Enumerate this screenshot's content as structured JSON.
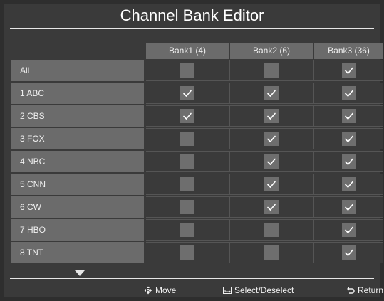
{
  "title": "Channel Bank Editor",
  "banks": [
    "Bank1 (4)",
    "Bank2 (6)",
    "Bank3 (36)"
  ],
  "channels": [
    {
      "name": "All",
      "b1": false,
      "b2": false,
      "b3": true
    },
    {
      "name": "1 ABC",
      "b1": true,
      "b2": true,
      "b3": true
    },
    {
      "name": "2 CBS",
      "b1": true,
      "b2": true,
      "b3": true
    },
    {
      "name": "3 FOX",
      "b1": false,
      "b2": true,
      "b3": true
    },
    {
      "name": "4 NBC",
      "b1": false,
      "b2": true,
      "b3": true
    },
    {
      "name": "5 CNN",
      "b1": false,
      "b2": true,
      "b3": true
    },
    {
      "name": "6 CW",
      "b1": false,
      "b2": true,
      "b3": true
    },
    {
      "name": "7 HBO",
      "b1": false,
      "b2": false,
      "b3": true
    },
    {
      "name": "8 TNT",
      "b1": false,
      "b2": false,
      "b3": true
    }
  ],
  "footer": {
    "move_label": "Move",
    "select_label": "Select/Deselect",
    "return_label": "Return"
  },
  "icons": {
    "move": "directional-pad-icon",
    "select": "enter-icon",
    "return": "return-arrow-icon",
    "check": "checkmark-icon",
    "scroll": "scroll-down-arrow-icon"
  },
  "colors": {
    "background": "#3a3a3a",
    "cell": "#6b6b6b",
    "checkbox": "#6e6e6e",
    "rule": "#e6e6e6",
    "text": "#ffffff"
  }
}
